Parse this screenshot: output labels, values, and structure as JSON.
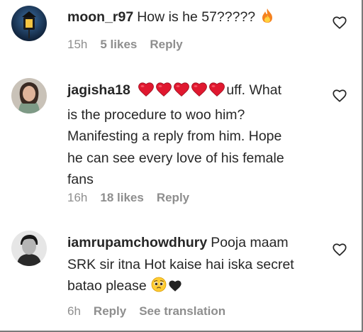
{
  "comments": [
    {
      "username": "moon_r97",
      "text": "How is he 57?????",
      "time": "15h",
      "likes": "5 likes",
      "reply": "Reply"
    },
    {
      "username": "jagisha18",
      "text_lines": [
        "uff. What",
        "is the procedure to woo him?",
        "Manifesting a reply from him. Hope",
        "he can see every love of his female",
        "fans"
      ],
      "time": "16h",
      "likes": "18 likes",
      "reply": "Reply"
    },
    {
      "username": "iamrupamchowdhury",
      "text_lines": [
        "Pooja maam",
        "SRK sir itna Hot kaise hai iska secret",
        "batao please"
      ],
      "time": "6h",
      "reply": "Reply",
      "see_translation": "See translation"
    }
  ],
  "icons": {
    "like": "heart-outline-icon",
    "fire": "fire-emoji",
    "red_heart": "red-heart-emoji",
    "pleading_face": "pleading-face-emoji",
    "black_heart": "black-heart-emoji"
  },
  "colors": {
    "text": "#262626",
    "muted": "#8e8e8e",
    "heart_red": "#e0182f"
  }
}
